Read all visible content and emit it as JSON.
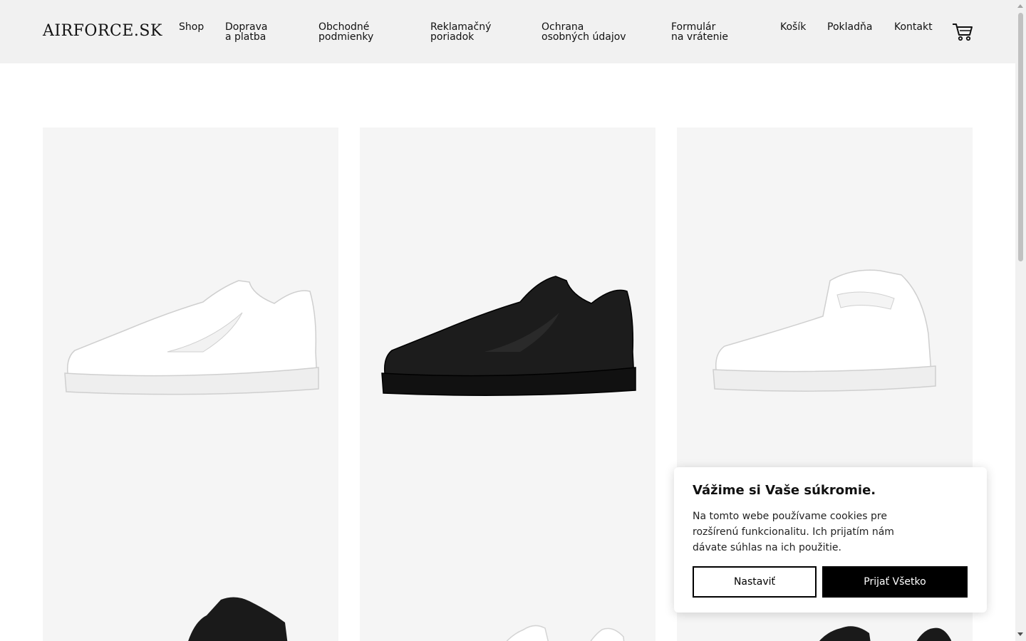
{
  "header": {
    "logo": "Airforce.sk",
    "nav": [
      {
        "label": "Shop"
      },
      {
        "label": "Doprava\na platba"
      },
      {
        "label": "Obchodné\npodmienky"
      },
      {
        "label": "Reklamačný\nporiadok"
      },
      {
        "label": "Ochrana\nosobných údajov"
      },
      {
        "label": "Formulár\nna vrátenie"
      },
      {
        "label": "Košík"
      },
      {
        "label": "Pokladňa"
      },
      {
        "label": "Kontakt"
      }
    ],
    "cart_icon": "cart-icon"
  },
  "products": [
    {
      "image": "white low sneaker",
      "color": "#ffffff"
    },
    {
      "image": "black low sneaker",
      "color": "#1a1a1a"
    },
    {
      "image": "white mid sneaker",
      "color": "#ffffff"
    },
    {
      "image": "black mid sneaker",
      "color": "#1a1a1a"
    },
    {
      "image": "white sneaker pair",
      "color": "#ffffff"
    },
    {
      "image": "black sneaker pair",
      "color": "#1a1a1a"
    }
  ],
  "cookie": {
    "title": "Vážime si Vaše súkromie.",
    "text": "Na tomto webe používame cookies pre rozšírenú funkcionalitu. Ich prijatím nám dávate súhlas na ich použitie.",
    "settings_label": "Nastaviť",
    "accept_label": "Prijať Všetko"
  },
  "colors": {
    "header_bg": "#f1f1f1",
    "card_bg": "#f5f5f5",
    "accent": "#000000"
  }
}
